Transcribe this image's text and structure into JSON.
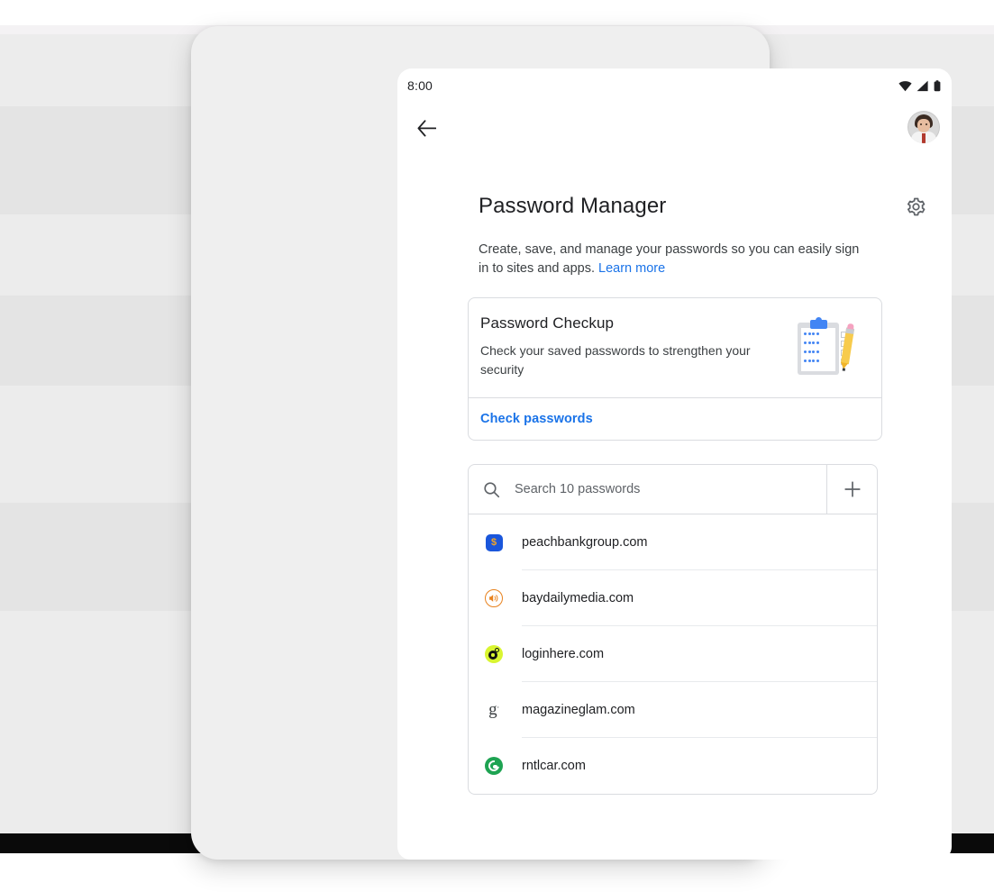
{
  "statusbar": {
    "time": "8:00",
    "icons": [
      "wifi-icon",
      "signal-icon",
      "battery-icon"
    ]
  },
  "appbar": {
    "back_icon": "back-arrow-icon",
    "avatar_alt": "account-avatar"
  },
  "header": {
    "title": "Password Manager",
    "settings_icon": "gear-icon",
    "description_before_link": "Create, save, and manage your passwords so you can easily sign in to sites and apps. ",
    "learn_more": "Learn more"
  },
  "checkup_card": {
    "title": "Password Checkup",
    "subtitle": "Check your saved passwords to strengthen your security",
    "illustration": "clipboard-pencil-illustration",
    "action_label": "Check passwords"
  },
  "search": {
    "icon": "search-icon",
    "placeholder": "Search 10 passwords",
    "value": "",
    "add_icon": "plus-icon",
    "add_label": "Add password"
  },
  "passwords": [
    {
      "domain": "peachbankgroup.com",
      "icon": "peachbankgroup-site-icon"
    },
    {
      "domain": "baydailymedia.com",
      "icon": "baydailymedia-site-icon"
    },
    {
      "domain": "loginhere.com",
      "icon": "loginhere-site-icon"
    },
    {
      "domain": "magazineglam.com",
      "icon": "magazineglam-site-icon"
    },
    {
      "domain": "rntlcar.com",
      "icon": "rntlcar-site-icon"
    }
  ],
  "colors": {
    "link": "#1a73e8",
    "text_primary": "#202124",
    "text_secondary": "#3c4043",
    "border": "#dadce0",
    "backdrop": "#ececec"
  }
}
